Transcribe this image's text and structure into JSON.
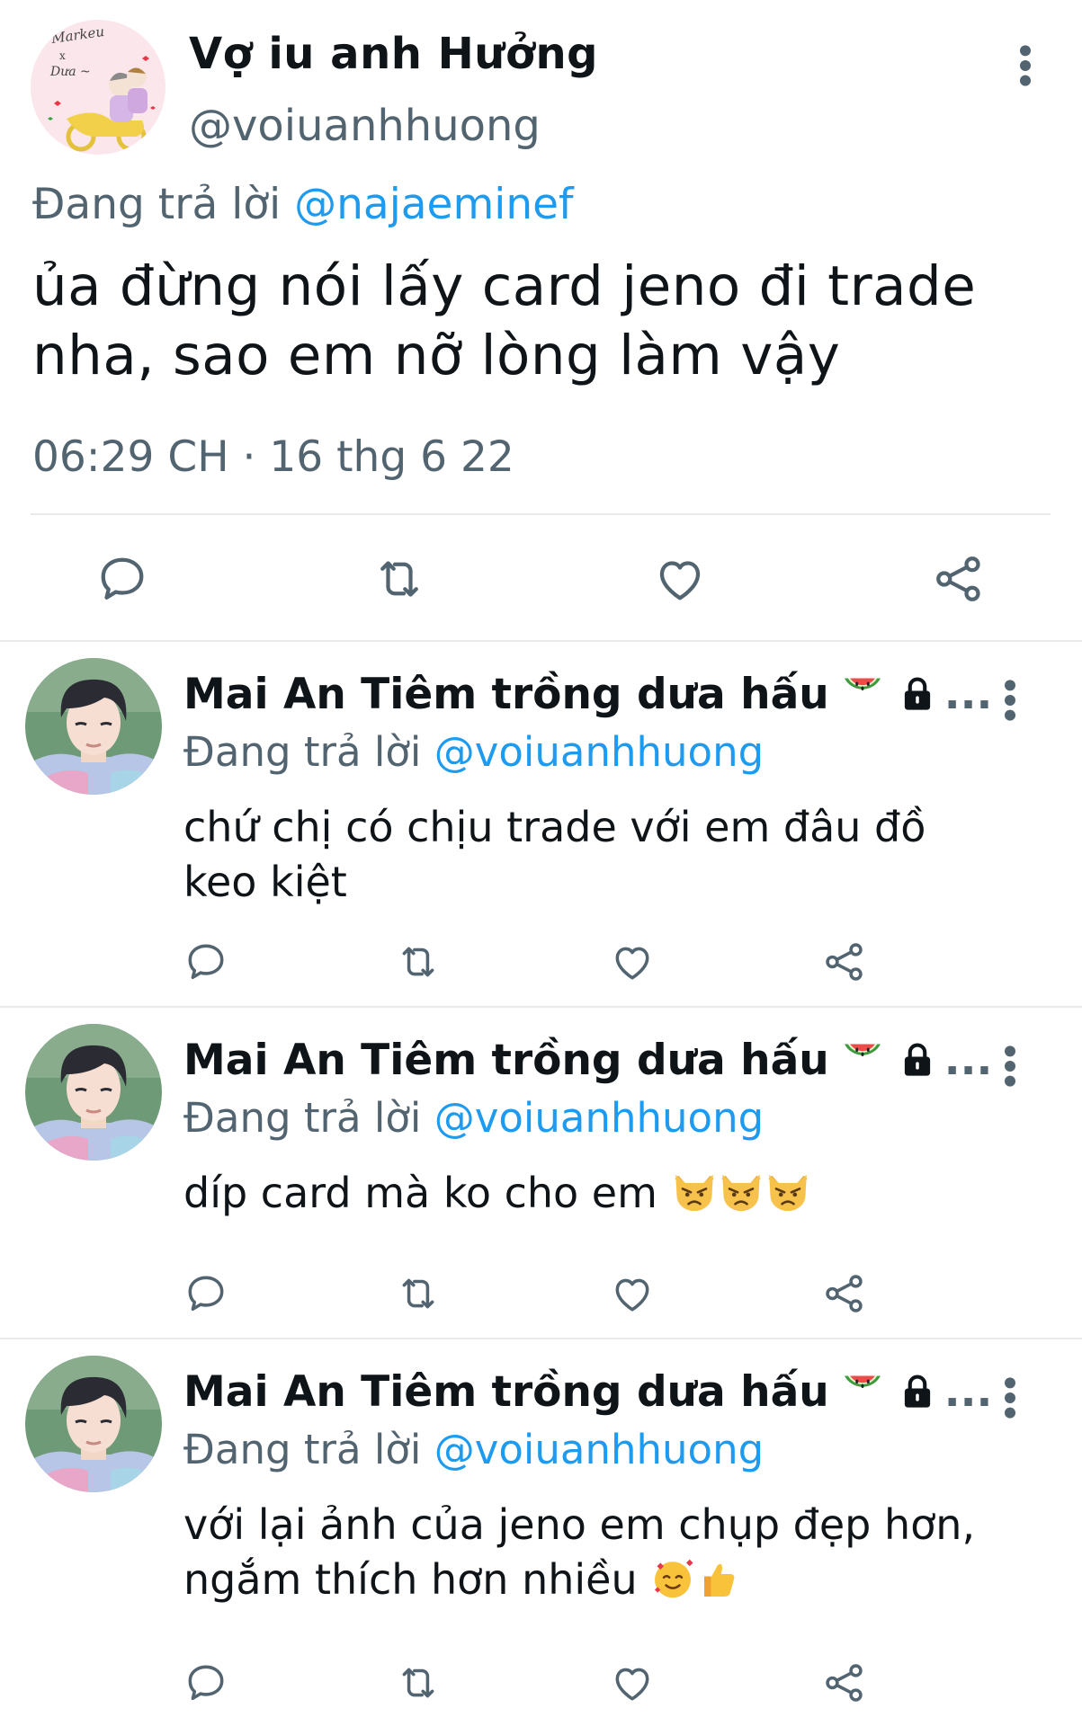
{
  "main_tweet": {
    "name": "Vợ iu anh Hưởng",
    "handle": "@voiuanhhuong",
    "avatar_caption_line1": "Markeu",
    "avatar_caption_line2": "x",
    "avatar_caption_line3": "Dưa ~",
    "replying_label": "Đang trả lời",
    "replying_to": "@najaeminef",
    "text": "ủa đừng nói lấy card jeno đi trade nha, sao em nỡ lòng làm vậy",
    "timestamp": "06:29 CH · 16 thg 6 22"
  },
  "replies": [
    {
      "name": "Mai An Tiêm trồng dưa hấu",
      "ellipsis": "...",
      "replying_label": "Đang trả lời",
      "replying_to": "@voiuanhhuong",
      "text": "chứ chị có chịu trade với em đâu đồ keo kiệt"
    },
    {
      "name": "Mai An Tiêm trồng dưa hấu",
      "ellipsis": "...",
      "replying_label": "Đang trả lời",
      "replying_to": "@voiuanhhuong",
      "text": "díp card mà ko cho em"
    },
    {
      "name": "Mai An Tiêm trồng dưa hấu",
      "ellipsis": "...",
      "replying_label": "Đang trả lời",
      "replying_to": "@voiuanhhuong",
      "text": "với lại ảnh của jeno em chụp đẹp hơn, ngắm thích hơn nhiều"
    }
  ],
  "icons": [
    "reply-icon",
    "retweet-icon",
    "like-icon",
    "share-icon",
    "more-icon",
    "watermelon-icon",
    "lock-icon",
    "pouting-cat-icon",
    "smiling-face-hearts-icon",
    "thumbs-up-icon"
  ],
  "colors": {
    "text": "#0f1419",
    "secondary": "#536471",
    "link": "#1d9bf0",
    "divider": "#e7e9ea"
  }
}
